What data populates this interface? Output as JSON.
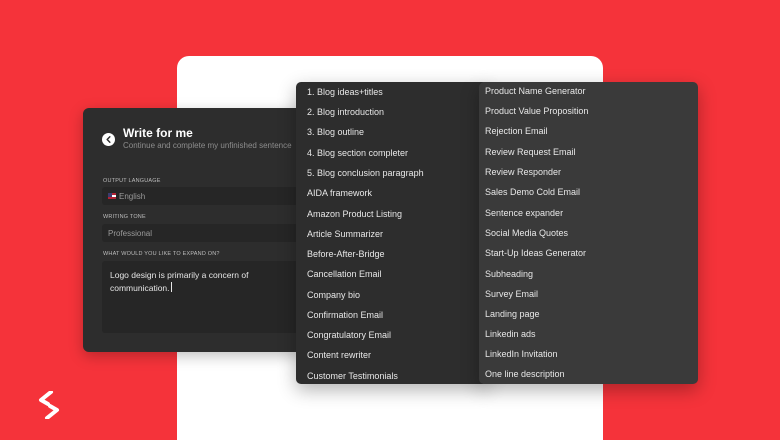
{
  "write_panel": {
    "title": "Write for me",
    "subtitle": "Continue and complete my unfinished sentence",
    "output_language_label": "OUTPUT LANGUAGE",
    "output_language_value": "English",
    "writing_tone_label": "WRITING TONE",
    "writing_tone_value": "Professional",
    "expand_label": "WHAT WOULD YOU LIKE TO EXPAND ON?",
    "expand_text": "Logo design is primarily a concern of communication."
  },
  "menu_left": [
    "1. Blog ideas+titles",
    "2. Blog introduction",
    "3. Blog outline",
    "4. Blog section completer",
    "5. Blog conclusion paragraph",
    "AIDA framework",
    "Amazon Product Listing",
    "Article Summarizer",
    "Before-After-Bridge",
    "Cancellation Email",
    "Company bio",
    "Confirmation Email",
    "Congratulatory Email",
    "Content rewriter",
    "Customer Testimonials"
  ],
  "menu_right": [
    "Product Name Generator",
    "Product Value Proposition",
    "Rejection Email",
    "Review Request Email",
    "Review Responder",
    "Sales Demo Cold Email",
    "Sentence expander",
    "Social Media Quotes",
    "Start-Up Ideas Generator",
    "Subheading",
    "Survey Email",
    "Landing page",
    "Linkedin ads",
    "LinkedIn Invitation",
    "One line description"
  ],
  "colors": {
    "background": "#f5333a",
    "card": "#ffffff",
    "panel": "#2d2d2d"
  },
  "icons": {
    "back": "arrow-left-circle-icon",
    "flag": "us-flag-icon",
    "logo": "brand-logo-icon"
  }
}
